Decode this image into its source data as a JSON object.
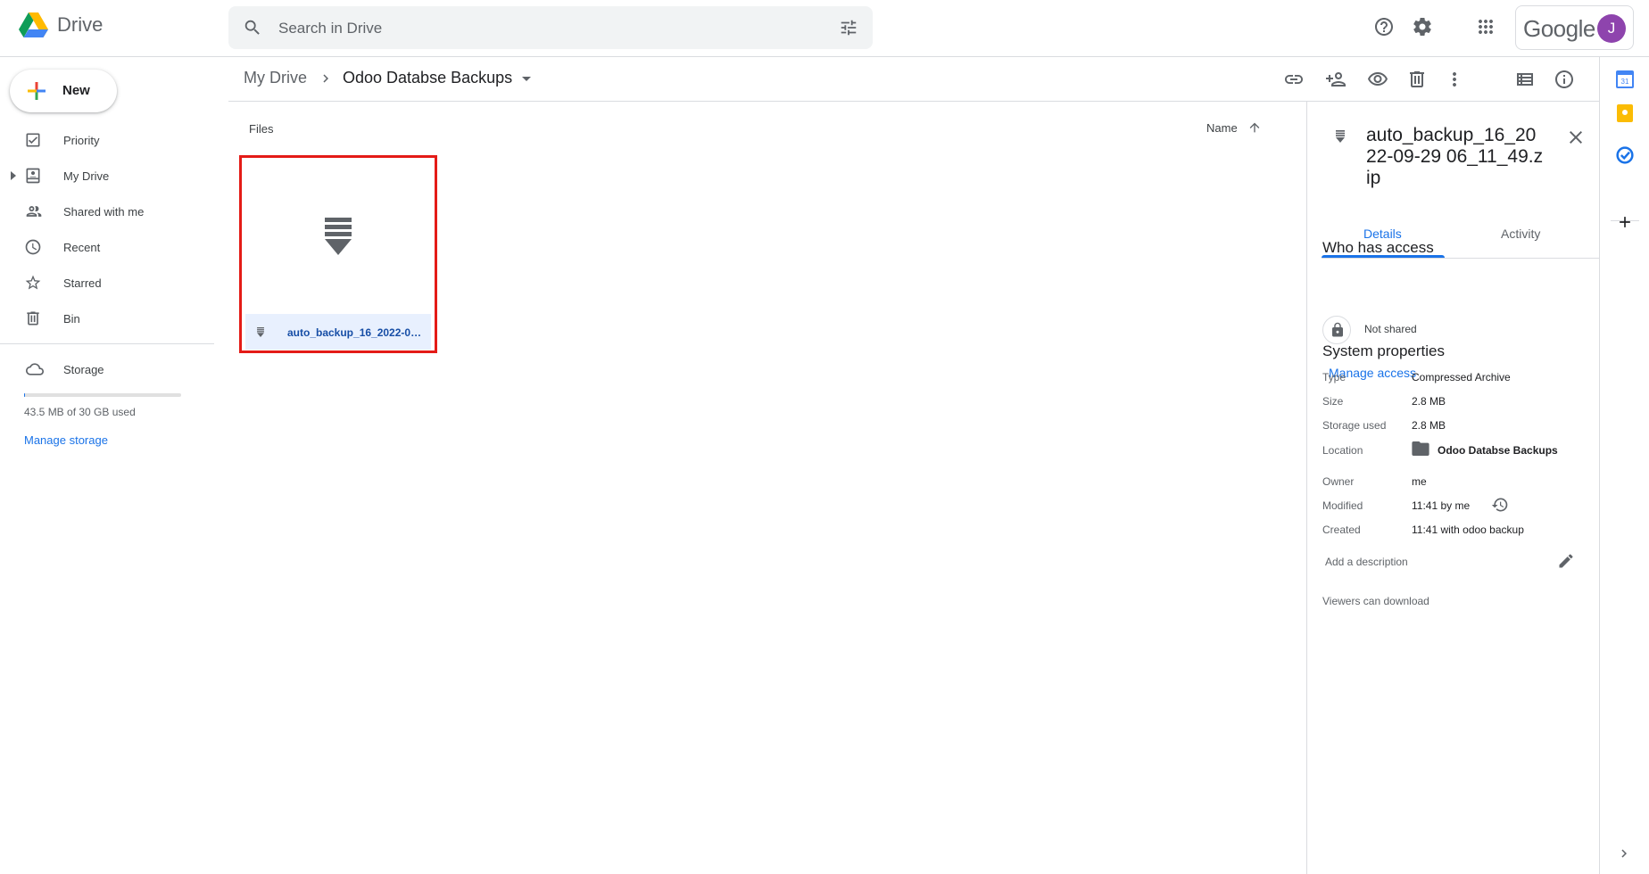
{
  "header": {
    "app_name": "Drive",
    "search_placeholder": "Search in Drive",
    "google_wordmark": "Google",
    "avatar_letter": "J"
  },
  "sidebar": {
    "new_label": "New",
    "items": [
      {
        "label": "Priority",
        "icon": "priority-icon"
      },
      {
        "label": "My Drive",
        "icon": "my-drive-icon"
      },
      {
        "label": "Shared with me",
        "icon": "shared-icon"
      },
      {
        "label": "Recent",
        "icon": "clock-icon"
      },
      {
        "label": "Starred",
        "icon": "star-icon"
      },
      {
        "label": "Bin",
        "icon": "trash-icon"
      }
    ],
    "storage_label": "Storage",
    "storage_used_text": "43.5 MB of 30 GB used",
    "storage_fraction": 0.0015,
    "manage_storage": "Manage storage"
  },
  "breadcrumb": {
    "root": "My Drive",
    "current": "Odoo Databse Backups"
  },
  "content": {
    "section_label": "Files",
    "sort_label": "Name",
    "file": {
      "name": "auto_backup_16_2022-0…",
      "icon": "zip-file-icon"
    }
  },
  "details": {
    "title": "auto_backup_16_2022-09-29 06_11_49.zip",
    "tabs": [
      "Details",
      "Activity"
    ],
    "who_has_access": "Who has access",
    "not_shared": "Not shared",
    "manage_access": "Manage access",
    "system_properties": "System properties",
    "props": {
      "type_label": "Type",
      "type_value": "Compressed Archive",
      "size_label": "Size",
      "size_value": "2.8 MB",
      "storage_label": "Storage used",
      "storage_value": "2.8 MB",
      "location_label": "Location",
      "location_value": "Odoo Databse Backups",
      "owner_label": "Owner",
      "owner_value": "me",
      "modified_label": "Modified",
      "modified_value": "11:41 by me",
      "created_label": "Created",
      "created_value": "11:41 with odoo backup"
    },
    "add_description": "Add a description",
    "viewers_download": "Viewers can download"
  },
  "colors": {
    "accent": "#1a73e8",
    "highlight_border": "#e41b17",
    "selected_bg": "#e8f0fe"
  }
}
